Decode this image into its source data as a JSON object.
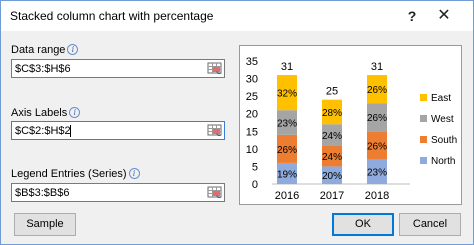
{
  "window": {
    "title": "Stacked column chart with percentage",
    "help_label": "?",
    "close_label": "✕"
  },
  "fields": [
    {
      "label": "Data range",
      "value": "$C$3:$H$6"
    },
    {
      "label": "Axis Labels",
      "value": "$C$2:$H$2"
    },
    {
      "label": "Legend Entries (Series)",
      "value": "$B$3:$B$6"
    }
  ],
  "info_glyph": "i",
  "buttons": {
    "sample": "Sample",
    "ok": "OK",
    "cancel": "Cancel"
  },
  "chart_data": {
    "type": "bar",
    "stacked": true,
    "categories": [
      "2016",
      "2017",
      "2018"
    ],
    "series": [
      {
        "name": "North",
        "values": [
          6,
          5,
          7
        ],
        "labels": [
          "19%",
          "20%",
          "23%"
        ],
        "color": "#8faadc"
      },
      {
        "name": "South",
        "values": [
          8,
          6,
          8
        ],
        "labels": [
          "26%",
          "24%",
          "26%"
        ],
        "color": "#ed7d31"
      },
      {
        "name": "West",
        "values": [
          7,
          6,
          8
        ],
        "labels": [
          "23%",
          "24%",
          "26%"
        ],
        "color": "#a5a5a5"
      },
      {
        "name": "East",
        "values": [
          10,
          7,
          8
        ],
        "labels": [
          "32%",
          "28%",
          "26%"
        ],
        "color": "#ffc000"
      }
    ],
    "totals": [
      "31",
      "25",
      "31"
    ],
    "yticks": [
      "0",
      "5",
      "10",
      "15",
      "20",
      "25",
      "30",
      "35"
    ],
    "ylim": [
      0,
      35
    ],
    "legend_position": "right",
    "legend_order": [
      "East",
      "West",
      "South",
      "North"
    ],
    "grid": false
  }
}
